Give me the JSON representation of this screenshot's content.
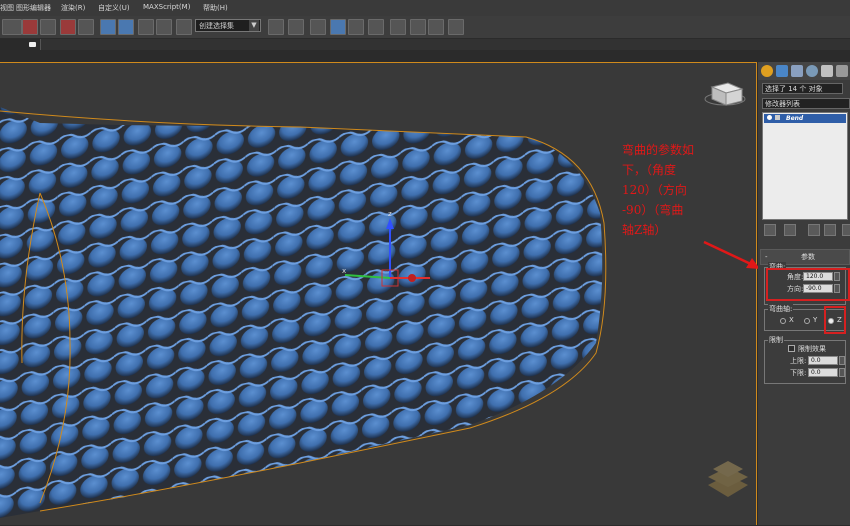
{
  "menu": {
    "items": [
      "视图",
      "图形编辑器",
      "渲染(R)",
      "自定义(U)",
      "MAXScript(M)",
      "帮助(H)"
    ]
  },
  "toolbar": {
    "selection_set_placeholder": "创建选择集"
  },
  "annotation": {
    "lines": [
      "弯曲的参数如",
      "下，（角度",
      "120）（方向",
      "-90）（弯曲",
      "轴Z轴）"
    ]
  },
  "command_panel": {
    "name_field": "选择了 14 个 对象",
    "modifier_list_label": "修改器列表",
    "stack": [
      {
        "label": "Bend",
        "selected": true
      }
    ],
    "params_rollout_title": "参数",
    "bend_group": {
      "title": "弯曲:",
      "angle_label": "角度:",
      "angle_value": "120.0",
      "direction_label": "方向:",
      "direction_value": "-90.0"
    },
    "axis_group": {
      "title": "弯曲轴:",
      "options": [
        "X",
        "Y",
        "Z"
      ],
      "selected": "Z"
    },
    "limits_group": {
      "title": "限制",
      "limit_effect_label": "限制效果",
      "upper_label": "上限:",
      "upper_value": "0.0",
      "lower_label": "下限:",
      "lower_value": "0.0"
    }
  },
  "viewport": {
    "gizmo_axes": [
      "x",
      "y",
      "z"
    ]
  },
  "colors": {
    "accent_orange": "#d08a1c",
    "mesh_blue": "#4f7fbf",
    "annotation_red": "#e01818",
    "highlight_red": "#d62020",
    "selected_blue": "#2f5ea8"
  }
}
